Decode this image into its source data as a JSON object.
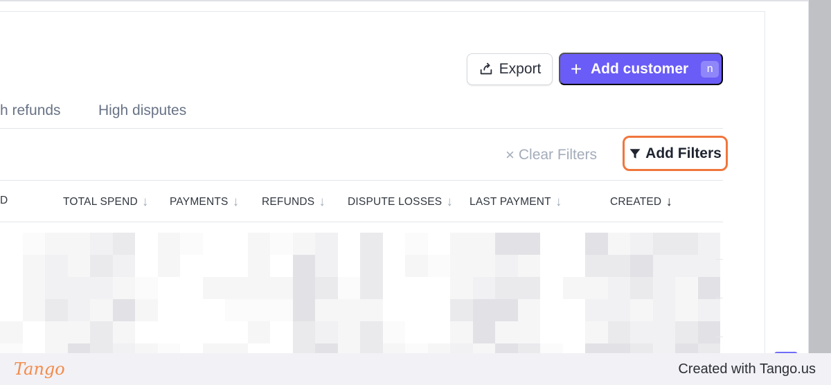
{
  "toolbar": {
    "export_label": "Export",
    "add_customer_label": "Add customer",
    "add_customer_shortcut": "n"
  },
  "tabs": [
    {
      "label": "h refunds"
    },
    {
      "label": "High disputes"
    }
  ],
  "filters": {
    "clear_label": "Clear Filters",
    "add_label": "Add Filters"
  },
  "table": {
    "columns": [
      {
        "label": "D"
      },
      {
        "label": "TOTAL SPEND"
      },
      {
        "label": "PAYMENTS"
      },
      {
        "label": "REFUNDS"
      },
      {
        "label": "DISPUTE LOSSES"
      },
      {
        "label": "LAST PAYMENT"
      },
      {
        "label": "CREATED"
      }
    ]
  },
  "footer": {
    "brand": "Tango",
    "created_with": "Created with Tango.us"
  },
  "colors": {
    "accent": "#6a5cf6",
    "highlight": "#f0763c",
    "brand": "#f28c4a"
  },
  "icons": {
    "export": "export-icon",
    "add": "plus-icon",
    "filter": "filter-icon",
    "clear": "close-icon",
    "sort": "arrow-down-icon"
  }
}
